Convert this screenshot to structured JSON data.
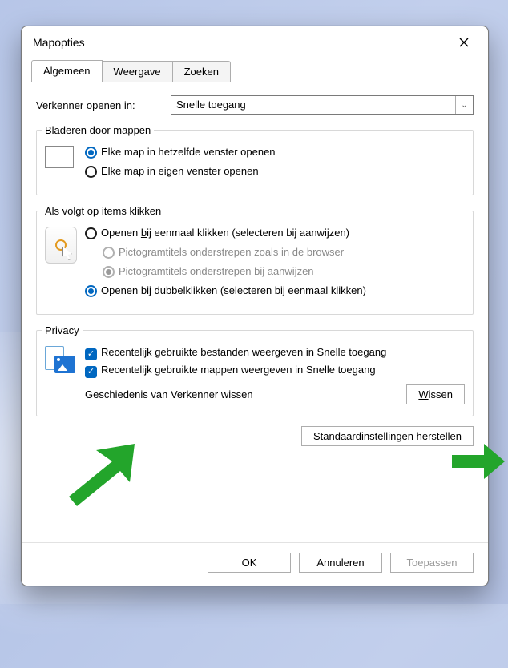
{
  "window": {
    "title": "Mapopties"
  },
  "tabs": {
    "general": "Algemeen",
    "view": "Weergave",
    "search": "Zoeken"
  },
  "open_in": {
    "label": "Verkenner openen in:",
    "value": "Snelle toegang"
  },
  "browse": {
    "legend": "Bladeren door mappen",
    "same_window": "Elke map in hetzelfde venster openen",
    "own_window": "Elke map in eigen venster openen"
  },
  "click": {
    "legend": "Als volgt op items klikken",
    "single_pre": "Openen ",
    "single_key": "b",
    "single_post": "ij eenmaal klikken (selecteren bij aanwijzen)",
    "underline_browser": "Pictogramtitels onderstrepen zoals in de browser",
    "underline_point_pre": "Pictogramtitels ",
    "underline_point_key": "o",
    "underline_point_post": "nderstrepen bij aanwijzen",
    "double": "Openen bij dubbelklikken (selecteren bij eenmaal klikken)"
  },
  "privacy": {
    "legend": "Privacy",
    "recent_files": "Recentelijk gebruikte bestanden weergeven in Snelle toegang",
    "recent_folders": "Recentelijk gebruikte mappen weergeven in Snelle toegang",
    "clear_label": "Geschiedenis van Verkenner wissen",
    "clear_btn_key": "W",
    "clear_btn_rest": "issen"
  },
  "restore": {
    "label_key": "S",
    "label_rest": "tandaardinstellingen herstellen"
  },
  "footer": {
    "ok": "OK",
    "cancel": "Annuleren",
    "apply": "Toepassen"
  }
}
